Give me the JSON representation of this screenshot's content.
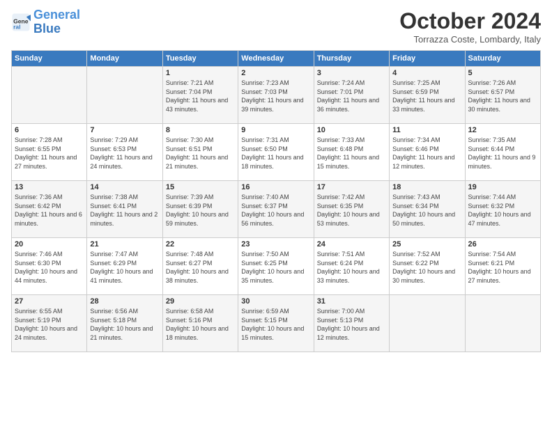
{
  "logo": {
    "line1": "General",
    "line2": "Blue"
  },
  "title": "October 2024",
  "subtitle": "Torrazza Coste, Lombardy, Italy",
  "weekdays": [
    "Sunday",
    "Monday",
    "Tuesday",
    "Wednesday",
    "Thursday",
    "Friday",
    "Saturday"
  ],
  "weeks": [
    [
      {
        "day": "",
        "info": ""
      },
      {
        "day": "",
        "info": ""
      },
      {
        "day": "1",
        "info": "Sunrise: 7:21 AM\nSunset: 7:04 PM\nDaylight: 11 hours and 43 minutes."
      },
      {
        "day": "2",
        "info": "Sunrise: 7:23 AM\nSunset: 7:03 PM\nDaylight: 11 hours and 39 minutes."
      },
      {
        "day": "3",
        "info": "Sunrise: 7:24 AM\nSunset: 7:01 PM\nDaylight: 11 hours and 36 minutes."
      },
      {
        "day": "4",
        "info": "Sunrise: 7:25 AM\nSunset: 6:59 PM\nDaylight: 11 hours and 33 minutes."
      },
      {
        "day": "5",
        "info": "Sunrise: 7:26 AM\nSunset: 6:57 PM\nDaylight: 11 hours and 30 minutes."
      }
    ],
    [
      {
        "day": "6",
        "info": "Sunrise: 7:28 AM\nSunset: 6:55 PM\nDaylight: 11 hours and 27 minutes."
      },
      {
        "day": "7",
        "info": "Sunrise: 7:29 AM\nSunset: 6:53 PM\nDaylight: 11 hours and 24 minutes."
      },
      {
        "day": "8",
        "info": "Sunrise: 7:30 AM\nSunset: 6:51 PM\nDaylight: 11 hours and 21 minutes."
      },
      {
        "day": "9",
        "info": "Sunrise: 7:31 AM\nSunset: 6:50 PM\nDaylight: 11 hours and 18 minutes."
      },
      {
        "day": "10",
        "info": "Sunrise: 7:33 AM\nSunset: 6:48 PM\nDaylight: 11 hours and 15 minutes."
      },
      {
        "day": "11",
        "info": "Sunrise: 7:34 AM\nSunset: 6:46 PM\nDaylight: 11 hours and 12 minutes."
      },
      {
        "day": "12",
        "info": "Sunrise: 7:35 AM\nSunset: 6:44 PM\nDaylight: 11 hours and 9 minutes."
      }
    ],
    [
      {
        "day": "13",
        "info": "Sunrise: 7:36 AM\nSunset: 6:42 PM\nDaylight: 11 hours and 6 minutes."
      },
      {
        "day": "14",
        "info": "Sunrise: 7:38 AM\nSunset: 6:41 PM\nDaylight: 11 hours and 2 minutes."
      },
      {
        "day": "15",
        "info": "Sunrise: 7:39 AM\nSunset: 6:39 PM\nDaylight: 10 hours and 59 minutes."
      },
      {
        "day": "16",
        "info": "Sunrise: 7:40 AM\nSunset: 6:37 PM\nDaylight: 10 hours and 56 minutes."
      },
      {
        "day": "17",
        "info": "Sunrise: 7:42 AM\nSunset: 6:35 PM\nDaylight: 10 hours and 53 minutes."
      },
      {
        "day": "18",
        "info": "Sunrise: 7:43 AM\nSunset: 6:34 PM\nDaylight: 10 hours and 50 minutes."
      },
      {
        "day": "19",
        "info": "Sunrise: 7:44 AM\nSunset: 6:32 PM\nDaylight: 10 hours and 47 minutes."
      }
    ],
    [
      {
        "day": "20",
        "info": "Sunrise: 7:46 AM\nSunset: 6:30 PM\nDaylight: 10 hours and 44 minutes."
      },
      {
        "day": "21",
        "info": "Sunrise: 7:47 AM\nSunset: 6:29 PM\nDaylight: 10 hours and 41 minutes."
      },
      {
        "day": "22",
        "info": "Sunrise: 7:48 AM\nSunset: 6:27 PM\nDaylight: 10 hours and 38 minutes."
      },
      {
        "day": "23",
        "info": "Sunrise: 7:50 AM\nSunset: 6:25 PM\nDaylight: 10 hours and 35 minutes."
      },
      {
        "day": "24",
        "info": "Sunrise: 7:51 AM\nSunset: 6:24 PM\nDaylight: 10 hours and 33 minutes."
      },
      {
        "day": "25",
        "info": "Sunrise: 7:52 AM\nSunset: 6:22 PM\nDaylight: 10 hours and 30 minutes."
      },
      {
        "day": "26",
        "info": "Sunrise: 7:54 AM\nSunset: 6:21 PM\nDaylight: 10 hours and 27 minutes."
      }
    ],
    [
      {
        "day": "27",
        "info": "Sunrise: 6:55 AM\nSunset: 5:19 PM\nDaylight: 10 hours and 24 minutes."
      },
      {
        "day": "28",
        "info": "Sunrise: 6:56 AM\nSunset: 5:18 PM\nDaylight: 10 hours and 21 minutes."
      },
      {
        "day": "29",
        "info": "Sunrise: 6:58 AM\nSunset: 5:16 PM\nDaylight: 10 hours and 18 minutes."
      },
      {
        "day": "30",
        "info": "Sunrise: 6:59 AM\nSunset: 5:15 PM\nDaylight: 10 hours and 15 minutes."
      },
      {
        "day": "31",
        "info": "Sunrise: 7:00 AM\nSunset: 5:13 PM\nDaylight: 10 hours and 12 minutes."
      },
      {
        "day": "",
        "info": ""
      },
      {
        "day": "",
        "info": ""
      }
    ]
  ]
}
